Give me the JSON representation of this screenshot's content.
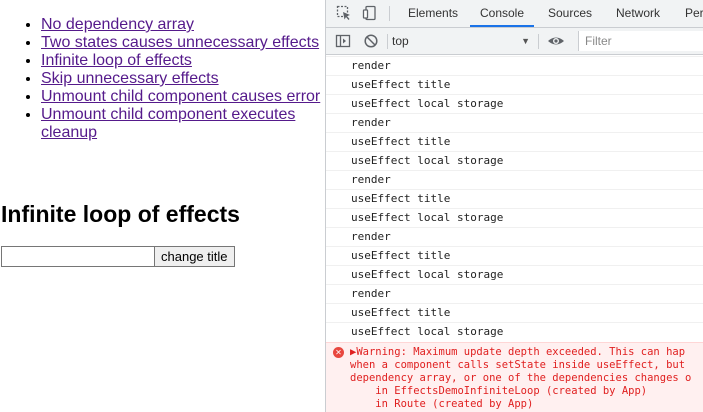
{
  "nav_links": [
    "No dependency array",
    "Two states causes unnecessary effects",
    "Infinite loop of effects",
    "Skip unnecessary effects",
    "Unmount child component causes error",
    "Unmount child component executes cleanup"
  ],
  "page": {
    "title": "Infinite loop of effects",
    "input_value": "",
    "button_label": "change title"
  },
  "devtools": {
    "tabs": [
      "Elements",
      "Console",
      "Sources",
      "Network",
      "Per"
    ],
    "active_tab": "Console",
    "context": "top",
    "filter_placeholder": "Filter",
    "log": [
      "render",
      "useEffect title",
      "useEffect local storage",
      "render",
      "useEffect title",
      "useEffect local storage",
      "render",
      "useEffect title",
      "useEffect local storage",
      "render",
      "useEffect title",
      "useEffect local storage",
      "render",
      "useEffect title",
      "useEffect local storage"
    ],
    "error": {
      "lines": [
        "▶Warning: Maximum update depth exceeded. This can hap",
        "when a component calls setState inside useEffect, but",
        "dependency array, or one of the dependencies changes o",
        "    in EffectsDemoInfiniteLoop (created by App)",
        "    in Route (created by App)"
      ]
    }
  }
}
